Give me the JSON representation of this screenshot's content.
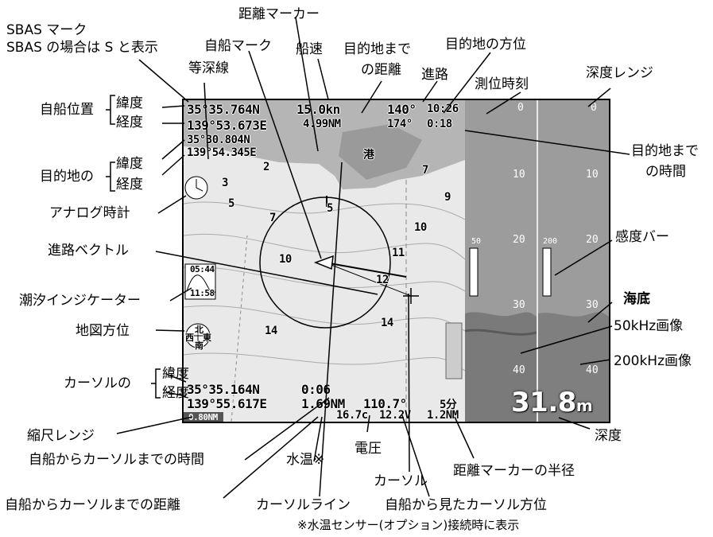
{
  "annotations": {
    "sbas_mark": "SBAS マーク",
    "sbas_note": "SBAS の場合は S と表示",
    "distance_marker": "距離マーカー",
    "own_ship_mark": "自船マーク",
    "boat_speed": "船速",
    "dest_distance_line1": "目的地まで",
    "dest_distance_line2": "の距離",
    "dest_bearing": "目的地の方位",
    "isobath": "等深線",
    "course": "進路",
    "fix_time": "測位時刻",
    "depth_range": "深度レンジ",
    "own_position": "自船位置",
    "latitude": "緯度",
    "longitude": "経度",
    "destination_of": "目的地の",
    "dest_time_line1": "目的地まで",
    "dest_time_line2": "の時間",
    "analog_clock": "アナログ時計",
    "sensitivity_bar": "感度バー",
    "course_vector": "進路ベクトル",
    "tide_indicator": "潮汐インジケーター",
    "seabed": "海底",
    "chart_orientation": "地図方位",
    "image_50khz": "50kHz画像",
    "image_200khz": "200kHz画像",
    "cursor_of": "カーソルの",
    "scale_range": "縮尺レンジ",
    "depth": "深度",
    "time_to_cursor": "自船からカーソルまでの時間",
    "water_temp": "水温※",
    "voltage": "電圧",
    "marker_radius": "距離マーカーの半径",
    "cursor": "カーソル",
    "distance_to_cursor": "自船からカーソルまでの距離",
    "cursor_line": "カーソルライン",
    "cursor_bearing": "自船から見たカーソル方位",
    "footnote": "※水温センサー(オプション)接続時に表示"
  },
  "screen": {
    "own_lat": "35°35.764N",
    "own_lon": "139°53.673E",
    "dest_lat": "35°30.804N",
    "dest_lon": "139°54.345E",
    "speed": "15.0kn",
    "dest_distance": "4.99NM",
    "course": "140°",
    "fix_time": "10:26",
    "dest_bearing": "174°",
    "time_to_dest": "0:18",
    "cursor_lat": "35°35.164N",
    "cursor_lon": "139°55.617E",
    "time_to_cursor": "0:06",
    "distance_to_cursor": "1.69NM",
    "cursor_bearing": "110.7°",
    "water_temp": "16.7c",
    "voltage": "12.2V",
    "marker_radius": "1.2NM",
    "marker_radius_unit": "5分",
    "depth_value": "31.8",
    "depth_unit": "m",
    "scale_range": "0.80NM",
    "tide_time_top": "05:44",
    "tide_time_bottom": "11:58",
    "harbor": "港",
    "compass_n": "北",
    "compass_e": "東",
    "compass_w": "西",
    "compass_s": "南",
    "gain_a": "50",
    "gain_b": "200",
    "depth_scale": [
      "0",
      "10",
      "20",
      "30",
      "40"
    ],
    "contours": [
      "3",
      "5",
      "7",
      "2",
      "5",
      "7",
      "9",
      "10",
      "10",
      "11",
      "12",
      "14",
      "14",
      "5"
    ]
  }
}
